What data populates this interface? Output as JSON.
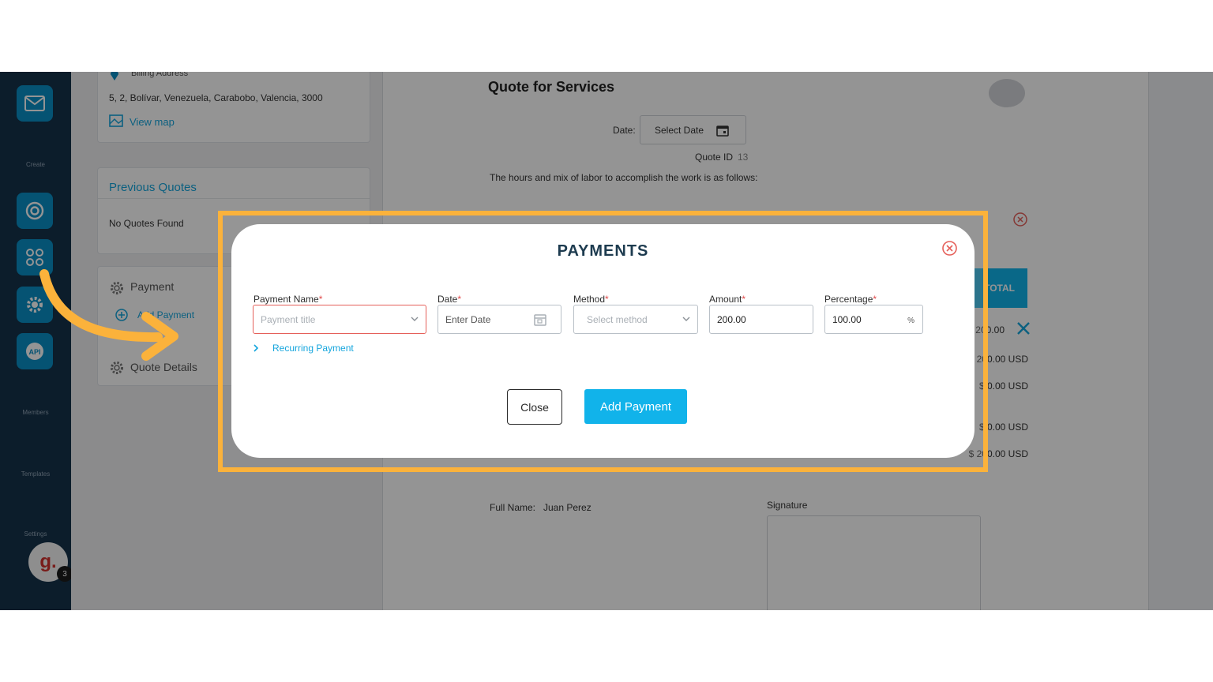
{
  "sidebar": {
    "labels": {
      "create": "Create",
      "members": "Members",
      "templates": "Templates",
      "settings": "Settings"
    },
    "avatar_letter": "g.",
    "avatar_badge": "3"
  },
  "left": {
    "billing_label": "Billing Address",
    "billing_address": "5, 2, Bolívar, Venezuela, Carabobo, Valencia, 3000",
    "view_map": "View map",
    "previous_quotes_title": "Previous Quotes",
    "no_quotes": "No Quotes Found",
    "payment_title": "Payment",
    "add_payment": "Add Payment",
    "quote_details": "Quote Details"
  },
  "doc": {
    "title": "Quote for Services",
    "date_label": "Date:",
    "date_button": "Select Date",
    "quote_id_label": "Quote ID",
    "quote_id": "13",
    "intro": "The hours and mix of labor to accomplish the work is as follows:",
    "total_header": "TOTAL",
    "amount_rows": [
      "$ 200.00",
      "200.00 USD",
      "$ 0.00 USD",
      "$ 0.00 USD",
      "$ 200.00 USD"
    ],
    "full_name_label": "Full Name:",
    "full_name": "Juan Perez",
    "signature_label": "Signature"
  },
  "modal": {
    "title": "PAYMENTS",
    "fields": {
      "payment_name": {
        "label": "Payment Name",
        "placeholder": "Payment title"
      },
      "date": {
        "label": "Date",
        "placeholder": "Enter Date"
      },
      "method": {
        "label": "Method",
        "placeholder": "Select method"
      },
      "amount": {
        "label": "Amount",
        "value": "200.00"
      },
      "percentage": {
        "label": "Percentage",
        "value": "100.00",
        "suffix": "%"
      }
    },
    "required_mark": "*",
    "recurring": "Recurring Payment",
    "close_button": "Close",
    "add_button": "Add Payment"
  },
  "colors": {
    "accent": "#11b3ea",
    "highlight": "#fbb23b",
    "error": "#e5605a",
    "sidebar": "#16324a"
  }
}
